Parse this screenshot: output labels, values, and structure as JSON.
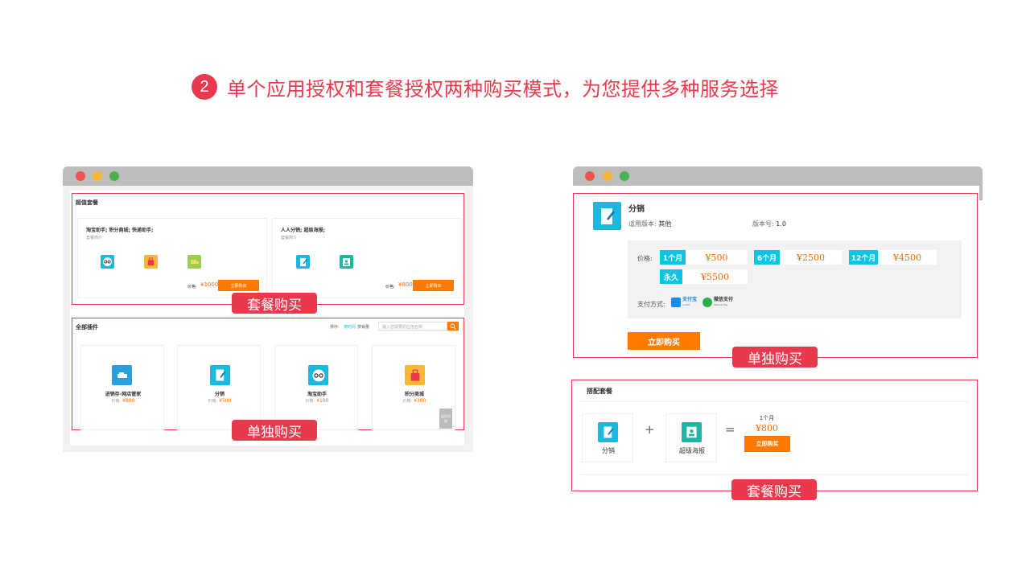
{
  "heading": {
    "number": "2",
    "text": "单个应用授权和套餐授权两种购买模式，为您提供多种服务选择"
  },
  "left_window": {
    "bundle_section": {
      "title": "超值套餐",
      "cards": [
        {
          "name": "淘宝助手; 积分商城; 快递助手;",
          "desc": "套餐简介",
          "price_label": "价格:",
          "price": "¥1000",
          "buy_label": "立即购买",
          "icons": [
            "glasses-icon",
            "gift-bag-icon",
            "truck-icon"
          ]
        },
        {
          "name": "人人分销; 超级海报;",
          "desc": "套餐简介",
          "price_label": "价格:",
          "price": "¥800",
          "buy_label": "立即购买",
          "icons": [
            "share-doc-icon",
            "poster-icon"
          ]
        }
      ],
      "tag": "套餐购买"
    },
    "plugins_section": {
      "title": "全部插件",
      "sort_label": "排序:",
      "sort_options": [
        "按时间",
        "按销量"
      ],
      "search_placeholder": "输入您需要的应用名称",
      "items": [
        {
          "name": "进销存-网店管家",
          "price_label": "价格:",
          "price": "¥800",
          "icon": "car-icon"
        },
        {
          "name": "分销",
          "price_label": "价格:",
          "price": "¥500",
          "icon": "share-doc-icon"
        },
        {
          "name": "淘宝助手",
          "price_label": "价格:",
          "price": "¥100",
          "icon": "glasses-icon"
        },
        {
          "name": "积分商城",
          "price_label": "价格:",
          "price": "¥300",
          "icon": "gift-bag-icon"
        }
      ],
      "back_top": "返回顶部",
      "tag": "单独购买"
    }
  },
  "right_window": {
    "product": {
      "name": "分销",
      "version_label": "适用版本:",
      "version_value": "其他",
      "build_label": "版本号:",
      "build_value": "1.0",
      "price_label": "价格:",
      "plans": [
        {
          "period": "1个月",
          "price": "¥500"
        },
        {
          "period": "6个月",
          "price": "¥2500"
        },
        {
          "period": "12个月",
          "price": "¥4500"
        },
        {
          "period": "永久",
          "price": "¥5500"
        }
      ],
      "pay_label": "支付方式:",
      "alipay": "支付宝",
      "alipay_sub": "ALIPAY",
      "wechat": "微信支付",
      "wechat_sub": "Wechat Pay",
      "buy_label": "立即购买",
      "tag": "单独购买"
    },
    "combo": {
      "title": "搭配套餐",
      "items": [
        {
          "name": "分销",
          "icon": "share-doc-icon"
        },
        {
          "name": "超级海报",
          "icon": "poster-icon"
        }
      ],
      "plus": "+",
      "equals": "=",
      "period": "1个月",
      "price": "¥800",
      "buy_label": "立即购买",
      "tag": "套餐购买"
    }
  },
  "colors": {
    "accent_red": "#e83a4c",
    "orange": "#ff7a00",
    "cyan": "#0ec3e3",
    "price": "#ff6a00"
  }
}
